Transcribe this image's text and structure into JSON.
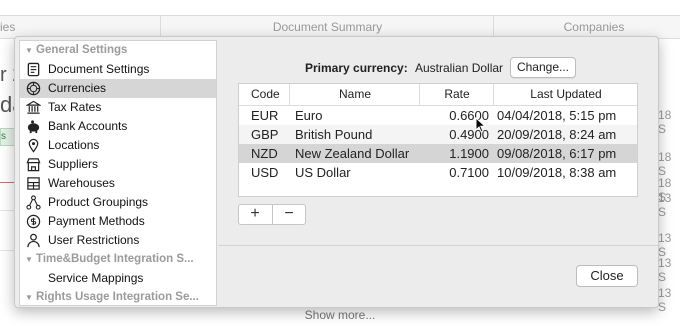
{
  "background": {
    "columns": [
      "ies",
      "Document Summary",
      "Companies"
    ],
    "left_text_1": "r 2",
    "left_text_2": "da",
    "left_badge": "s",
    "right_values": [
      "18 S",
      "18 S",
      "18 S",
      "13 S",
      "13 S",
      "13 S",
      "13 S"
    ],
    "show_more": "Show more..."
  },
  "sidebar": {
    "groups": [
      {
        "label": "General Settings",
        "icon": "triangle-down-icon"
      },
      {
        "label": "Time&Budget Integration S...",
        "icon": "triangle-down-icon"
      },
      {
        "label": "Rights Usage Integration Se...",
        "icon": "triangle-down-icon"
      }
    ],
    "items": [
      {
        "label": "Document Settings",
        "icon": "document-icon"
      },
      {
        "label": "Currencies",
        "icon": "currency-icon"
      },
      {
        "label": "Tax Rates",
        "icon": "bank-building-icon"
      },
      {
        "label": "Bank Accounts",
        "icon": "piggy-bank-icon"
      },
      {
        "label": "Locations",
        "icon": "map-pin-icon"
      },
      {
        "label": "Suppliers",
        "icon": "storefront-icon"
      },
      {
        "label": "Warehouses",
        "icon": "warehouse-icon"
      },
      {
        "label": "Product Groupings",
        "icon": "hierarchy-icon"
      },
      {
        "label": "Payment Methods",
        "icon": "payment-icon"
      },
      {
        "label": "User Restrictions",
        "icon": "user-icon"
      },
      {
        "label": "Service Mappings",
        "icon": ""
      }
    ],
    "selected_index": 1
  },
  "primary": {
    "label": "Primary currency:",
    "value": "Australian Dollar",
    "change_label": "Change..."
  },
  "table": {
    "headers": [
      "Code",
      "Name",
      "Rate",
      "Last Updated"
    ],
    "rows": [
      {
        "code": "EUR",
        "name": "Euro",
        "rate": "0.6600",
        "updated": "04/04/2018, 5:15 pm"
      },
      {
        "code": "GBP",
        "name": "British Pound",
        "rate": "0.4900",
        "updated": "20/09/2018, 8:24 am"
      },
      {
        "code": "NZD",
        "name": "New Zealand Dollar",
        "rate": "1.1900",
        "updated": "09/08/2018, 6:17 pm"
      },
      {
        "code": "USD",
        "name": "US Dollar",
        "rate": "0.7100",
        "updated": "10/09/2018, 8:38 am"
      }
    ],
    "selected_row": 2
  },
  "controls": {
    "add": "+",
    "remove": "−",
    "close": "Close"
  }
}
